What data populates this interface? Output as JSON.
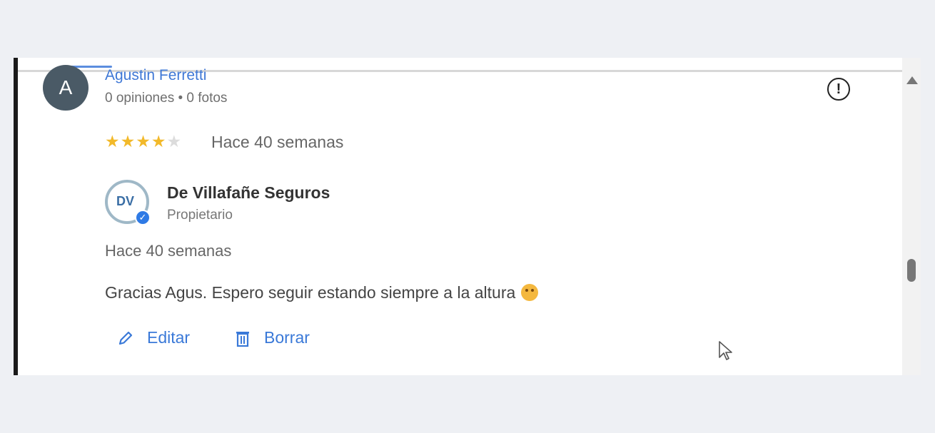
{
  "reviewer": {
    "avatar_letter": "A",
    "name": "Agustin Ferretti",
    "meta": "0 opiniones • 0 fotos",
    "rating": 4,
    "rating_max": 5,
    "stars_on": "★★★★",
    "stars_off": "★",
    "date": "Hace 40 semanas"
  },
  "owner": {
    "logo_text": "DV",
    "name": "De Villafañe Seguros",
    "role": "Propietario",
    "verified_icon": "check-badge-icon"
  },
  "reply": {
    "date": "Hace 40 semanas",
    "text": "Gracias Agus. Espero seguir estando siempre a la altura"
  },
  "actions": {
    "edit_label": "Editar",
    "delete_label": "Borrar"
  },
  "colors": {
    "accent_blue": "#3a79d8",
    "star_gold": "#f2b92a",
    "avatar_bg": "#4a5a66"
  }
}
